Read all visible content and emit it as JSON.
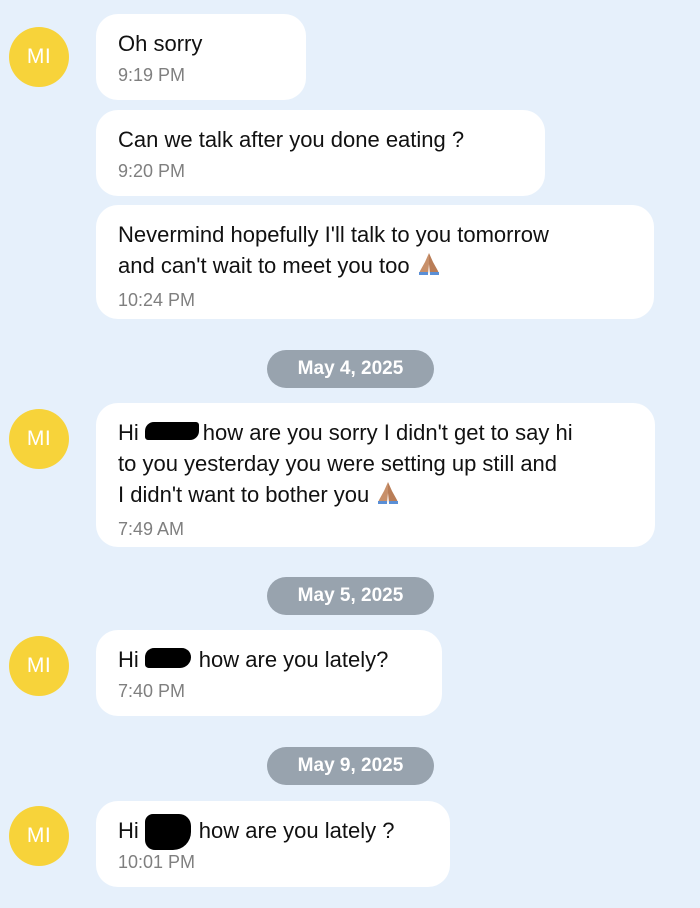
{
  "avatar_initials": "MI",
  "colors": {
    "background": "#e6f0fb",
    "avatar": "#f7d33a",
    "bubble": "#ffffff",
    "date_pill": "#98a3ae",
    "time_text": "#7f7f7f"
  },
  "messages": [
    {
      "line1": "Oh sorry",
      "time": "9:19 PM"
    },
    {
      "line1": "Can we talk after you done eating ?",
      "time": "9:20 PM"
    },
    {
      "line1": "Nevermind hopefully I'll talk to you tomorrow",
      "line2": "and can't wait to meet you too",
      "emoji": "folded-hands",
      "time": "10:24 PM"
    },
    {
      "greeting": "Hi",
      "line1_rest": "how are you sorry I didn't get to say hi",
      "line2": "to you yesterday you were setting up still and",
      "line3": "I didn't want to bother you",
      "emoji": "folded-hands",
      "time": "7:49 AM"
    },
    {
      "greeting": "Hi",
      "line1_rest": "how are you lately?",
      "time": "7:40 PM"
    },
    {
      "greeting": "Hi",
      "line1_rest": "how are you lately ?",
      "time": "10:01 PM"
    }
  ],
  "date_separators": [
    "May 4, 2025",
    "May 5, 2025",
    "May 9, 2025"
  ]
}
